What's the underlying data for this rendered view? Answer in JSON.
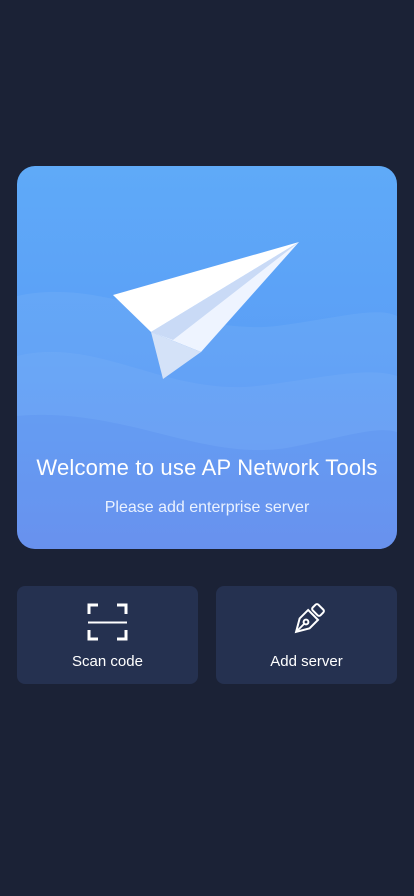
{
  "hero": {
    "title": "Welcome to use AP Network Tools",
    "subtitle": "Please add enterprise server",
    "icon": "paper-plane-icon"
  },
  "actions": [
    {
      "label": "Scan code",
      "icon": "scan-icon"
    },
    {
      "label": "Add server",
      "icon": "pen-icon"
    }
  ],
  "colors": {
    "background": "#1b2236",
    "card": "#253150",
    "hero_gradient_top": "#5faaf8",
    "hero_gradient_bottom": "#5f8cf0",
    "text": "#ffffff"
  }
}
